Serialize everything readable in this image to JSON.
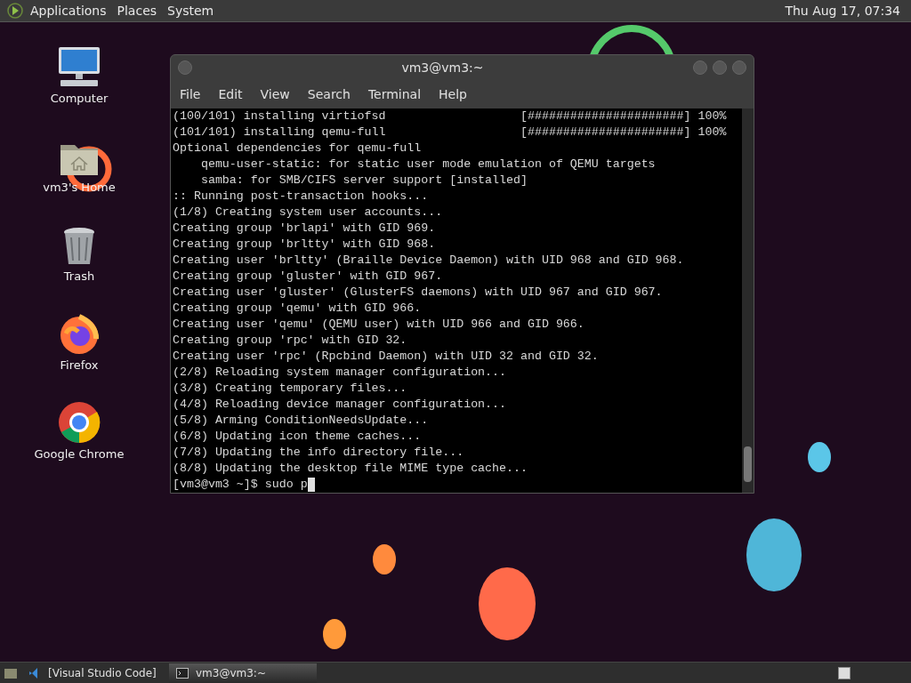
{
  "top_panel": {
    "menus": [
      "Applications",
      "Places",
      "System"
    ],
    "clock": "Thu Aug 17, 07:34"
  },
  "desktop_icons": [
    {
      "kind": "computer",
      "label": "Computer"
    },
    {
      "kind": "home",
      "label": "vm3's Home"
    },
    {
      "kind": "trash",
      "label": "Trash"
    },
    {
      "kind": "firefox",
      "label": "Firefox"
    },
    {
      "kind": "chrome",
      "label": "Google Chrome"
    }
  ],
  "terminal": {
    "title": "vm3@vm3:~",
    "menu": [
      "File",
      "Edit",
      "View",
      "Search",
      "Terminal",
      "Help"
    ],
    "lines": [
      "(100/101) installing virtiofsd                   [######################] 100%",
      "(101/101) installing qemu-full                   [######################] 100%",
      "Optional dependencies for qemu-full",
      "    qemu-user-static: for static user mode emulation of QEMU targets",
      "    samba: for SMB/CIFS server support [installed]",
      ":: Running post-transaction hooks...",
      "(1/8) Creating system user accounts...",
      "Creating group 'brlapi' with GID 969.",
      "Creating group 'brltty' with GID 968.",
      "Creating user 'brltty' (Braille Device Daemon) with UID 968 and GID 968.",
      "Creating group 'gluster' with GID 967.",
      "Creating user 'gluster' (GlusterFS daemons) with UID 967 and GID 967.",
      "Creating group 'qemu' with GID 966.",
      "Creating user 'qemu' (QEMU user) with UID 966 and GID 966.",
      "Creating group 'rpc' with GID 32.",
      "Creating user 'rpc' (Rpcbind Daemon) with UID 32 and GID 32.",
      "(2/8) Reloading system manager configuration...",
      "(3/8) Creating temporary files...",
      "(4/8) Reloading device manager configuration...",
      "(5/8) Arming ConditionNeedsUpdate...",
      "(6/8) Updating icon theme caches...",
      "(7/8) Updating the info directory file...",
      "(8/8) Updating the desktop file MIME type cache..."
    ],
    "prompt": "[vm3@vm3 ~]$ sudo p"
  },
  "taskbar": {
    "items": [
      {
        "label": "[Visual Studio Code]",
        "selected": false
      },
      {
        "label": "vm3@vm3:~",
        "selected": true
      }
    ]
  }
}
